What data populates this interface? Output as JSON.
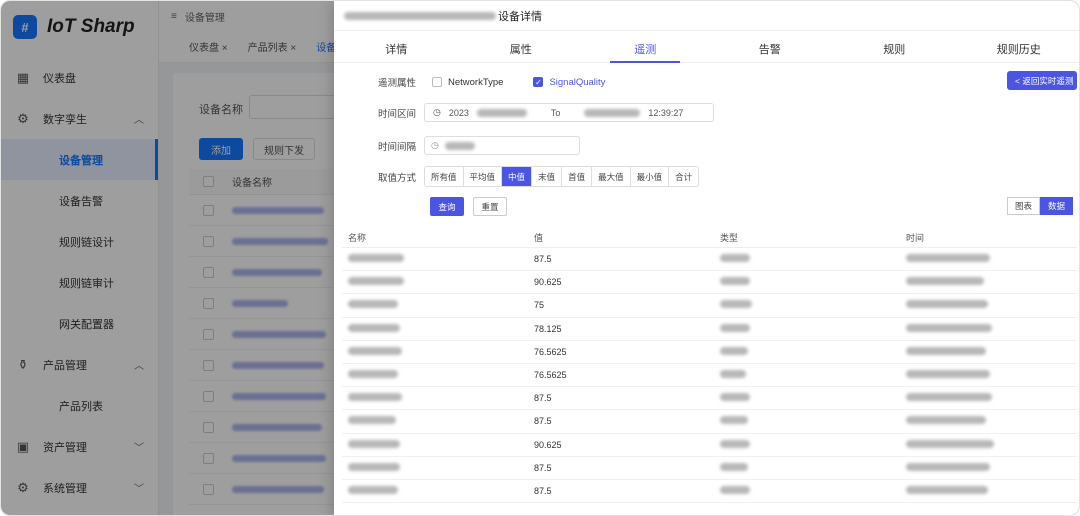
{
  "app": {
    "logo_mark": "#",
    "logo_text": "IoT Sharp"
  },
  "sidebar": {
    "items": [
      {
        "label": "仪表盘"
      },
      {
        "label": "数字孪生"
      },
      {
        "label": "设备管理"
      },
      {
        "label": "设备告警"
      },
      {
        "label": "规则链设计"
      },
      {
        "label": "规则链审计"
      },
      {
        "label": "网关配置器"
      },
      {
        "label": "产品管理"
      },
      {
        "label": "产品列表"
      },
      {
        "label": "资产管理"
      },
      {
        "label": "系统管理"
      }
    ]
  },
  "topbar": {
    "breadcrumb": "设备管理",
    "menu_glyph": "≡"
  },
  "tabs": [
    {
      "label": "仪表盘 ×"
    },
    {
      "label": "产品列表 ×"
    },
    {
      "label": "设备"
    }
  ],
  "list": {
    "name_label": "设备名称",
    "add_button": "添加",
    "rule_button": "规则下发",
    "column_name": "设备名称"
  },
  "drawer": {
    "title_suffix": "设备详情",
    "tabs": [
      {
        "label": "详情"
      },
      {
        "label": "属性"
      },
      {
        "label": "遥测"
      },
      {
        "label": "告警"
      },
      {
        "label": "规则"
      },
      {
        "label": "规则历史"
      }
    ],
    "telemetry_label": "遥测属性",
    "telemetry_options": [
      {
        "label": "NetworkType",
        "checked": false
      },
      {
        "label": "SignalQuality",
        "checked": true
      }
    ],
    "return_button": "< 返回实时遥测",
    "range_label": "时间区间",
    "range_start": "2023",
    "range_sep": "To",
    "range_end": "12:39:27",
    "interval_label": "时间间隔",
    "mode_label": "取值方式",
    "modes": [
      {
        "label": "所有值"
      },
      {
        "label": "平均值"
      },
      {
        "label": "中值"
      },
      {
        "label": "末值"
      },
      {
        "label": "首值"
      },
      {
        "label": "最大值"
      },
      {
        "label": "最小值"
      },
      {
        "label": "合计"
      }
    ],
    "query_button": "查询",
    "reset_button": "重置",
    "view_chart": "图表",
    "view_data": "数据",
    "columns": [
      "名称",
      "值",
      "类型",
      "时间"
    ],
    "rows": [
      {
        "value": "87.5"
      },
      {
        "value": "90.625"
      },
      {
        "value": "75"
      },
      {
        "value": "78.125"
      },
      {
        "value": "76.5625"
      },
      {
        "value": "76.5625"
      },
      {
        "value": "87.5"
      },
      {
        "value": "87.5"
      },
      {
        "value": "90.625"
      },
      {
        "value": "87.5"
      },
      {
        "value": "87.5"
      }
    ]
  }
}
